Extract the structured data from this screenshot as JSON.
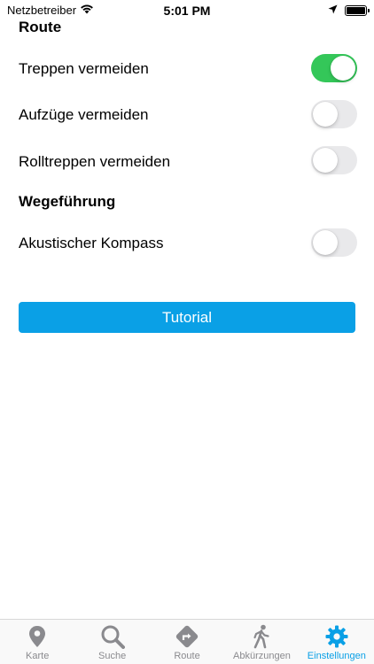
{
  "status_bar": {
    "carrier": "Netzbetreiber",
    "time": "5:01 PM",
    "icons": [
      "wifi-icon",
      "location-arrow-icon",
      "battery-icon"
    ]
  },
  "sections": {
    "route_title": "Route",
    "guidance_title": "Wegeführung"
  },
  "settings": {
    "avoid_stairs": {
      "label": "Treppen vermeiden",
      "on": true
    },
    "avoid_elevators": {
      "label": "Aufzüge vermeiden",
      "on": false
    },
    "avoid_escalators": {
      "label": "Rolltreppen vermeiden",
      "on": false
    },
    "acoustic_compass": {
      "label": "Akustischer Kompass",
      "on": false
    }
  },
  "tutorial_button": {
    "label": "Tutorial"
  },
  "tab_bar": {
    "active": "Einstellungen",
    "tabs": [
      {
        "label": "Karte",
        "icon": "map-pin-icon"
      },
      {
        "label": "Suche",
        "icon": "search-icon"
      },
      {
        "label": "Route",
        "icon": "route-sign-icon"
      },
      {
        "label": "Abkürzungen",
        "icon": "walking-person-icon"
      },
      {
        "label": "Einstellungen",
        "icon": "gear-icon"
      }
    ]
  },
  "colors": {
    "accent": "#0aa0e6",
    "toggle_on": "#34c759",
    "toggle_off": "#e9e9eb",
    "tab_inactive": "#8a8a8e"
  }
}
